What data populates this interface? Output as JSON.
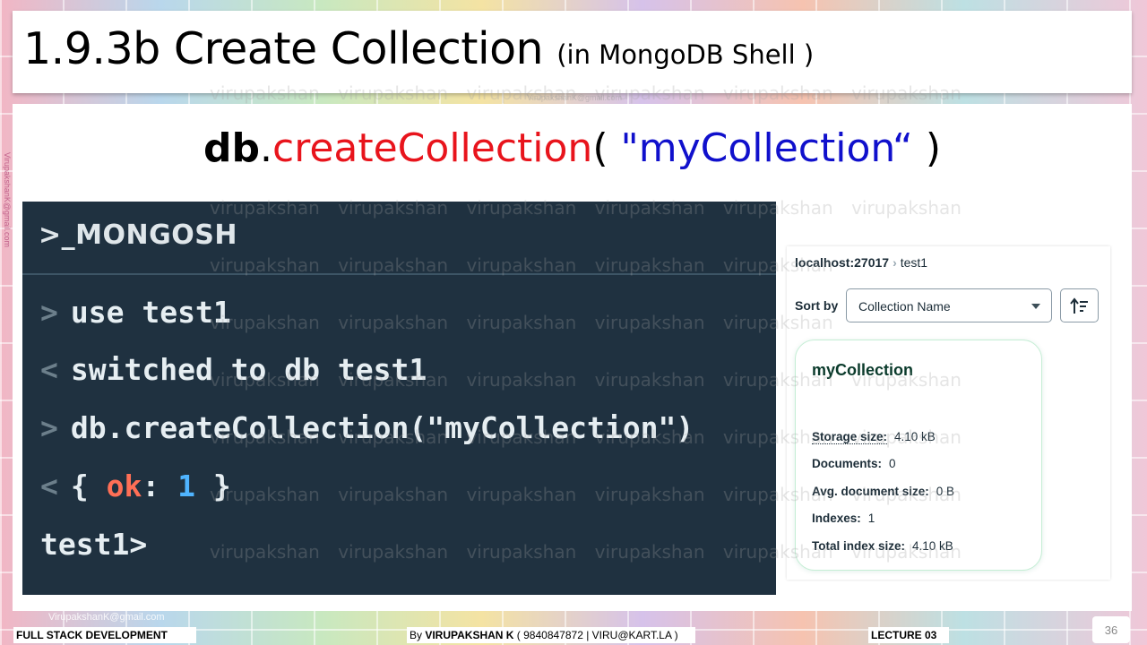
{
  "slide": {
    "title": "1.9.3b Create Collection",
    "title_note": "(in MongoDB Shell  )",
    "command": {
      "db": "db",
      "dot": ".",
      "method": "createCollection",
      "open_paren": "( ",
      "argument": "\"myCollection“",
      "close_paren": " )"
    },
    "watermark_word": "virupakshan",
    "watermark_email": "VirupakshanK@gmail.com",
    "side_email": "VirupakshanK@gmail.com"
  },
  "terminal": {
    "header": ">_MONGOSH",
    "lines": [
      {
        "prompt": ">",
        "text": "use test1"
      },
      {
        "prompt": "<",
        "text": "switched to db test1"
      },
      {
        "prompt": ">",
        "text": "db.createCollection(\"myCollection\")"
      },
      {
        "prompt": "<",
        "open": "{ ",
        "key": "ok",
        "colon": ": ",
        "value": "1",
        "close": " }"
      },
      {
        "prompt": "",
        "text": "test1>"
      }
    ]
  },
  "compass": {
    "breadcrumb_host": "localhost:27017",
    "breadcrumb_db": "test1",
    "sort_label": "Sort by",
    "sort_value": "Collection Name",
    "card": {
      "name": "myCollection",
      "stats": [
        {
          "label": "Storage size:",
          "value": "4.10 kB"
        },
        {
          "label": "Documents:",
          "value": "0"
        },
        {
          "label": "Avg. document size:",
          "value": "0 B"
        },
        {
          "label": "Indexes:",
          "value": "1"
        },
        {
          "label": "Total index size:",
          "value": "4.10 kB"
        }
      ]
    }
  },
  "footer": {
    "course": "FULL STACK DEVELOPMENT",
    "author_prefix": "By ",
    "author_name": "VIRUPAKSHAN K",
    "author_contact": " ( 9840847872 | VIRU@KART.LA )",
    "lecture": "LECTURE 03",
    "email": "VirupakshanK@gmail.com",
    "email_right": "VirupakshanK@gmail.com",
    "page": "36"
  }
}
